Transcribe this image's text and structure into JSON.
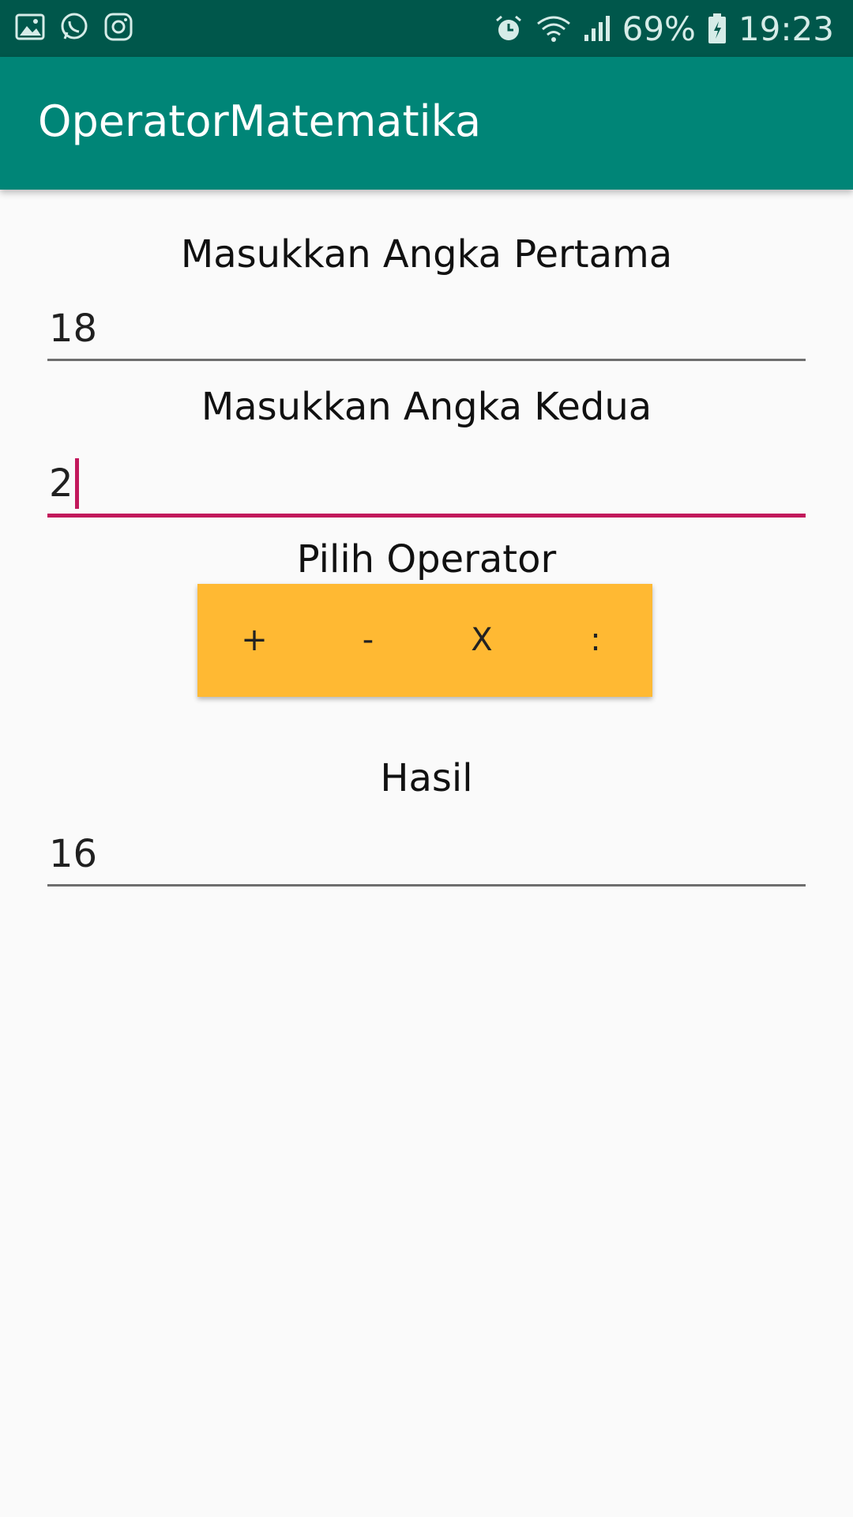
{
  "status_bar": {
    "battery": "69%",
    "time": "19:23",
    "left_icons": [
      "gallery-icon",
      "whatsapp-icon",
      "instagram-icon"
    ],
    "right_icons": [
      "alarm-icon",
      "wifi-icon",
      "signal-icon",
      "battery-icon"
    ]
  },
  "app_bar": {
    "title": "OperatorMatematika",
    "color": "#008577"
  },
  "form": {
    "first_label": "Masukkan Angka Pertama",
    "first_value": "18",
    "second_label": "Masukkan Angka Kedua",
    "second_value": "2",
    "operator_label": "Pilih Operator",
    "operators": [
      "+",
      "-",
      "X",
      ":"
    ],
    "result_label": "Hasil",
    "result_value": "16"
  },
  "colors": {
    "accent": "#c2185b",
    "button": "#ffb933",
    "status_bar": "#00574b"
  }
}
